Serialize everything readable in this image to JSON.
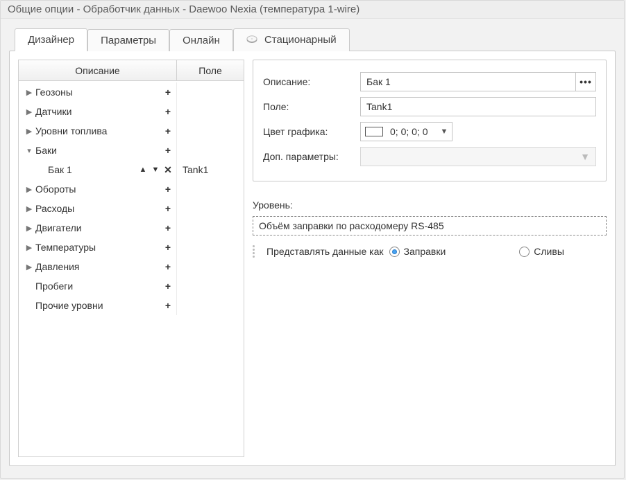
{
  "window": {
    "title": "Общие опции - Обработчик данных - Daewoo Nexia (температура 1-wire)"
  },
  "tabs": [
    {
      "label": "Дизайнер",
      "active": true
    },
    {
      "label": "Параметры",
      "active": false
    },
    {
      "label": "Онлайн",
      "active": false
    },
    {
      "label": "Стационарный",
      "active": false,
      "icon": "disk"
    }
  ],
  "tree": {
    "header": {
      "description": "Описание",
      "field": "Поле"
    },
    "rows": [
      {
        "label": "Геозоны",
        "expandable": true,
        "expanded": false
      },
      {
        "label": "Датчики",
        "expandable": true,
        "expanded": false
      },
      {
        "label": "Уровни топлива",
        "expandable": true,
        "expanded": false
      },
      {
        "label": "Баки",
        "expandable": true,
        "expanded": true,
        "children": [
          {
            "label": "Бак 1",
            "field": "Tank1",
            "selected": true
          }
        ]
      },
      {
        "label": "Обороты",
        "expandable": true,
        "expanded": false
      },
      {
        "label": "Расходы",
        "expandable": true,
        "expanded": false
      },
      {
        "label": "Двигатели",
        "expandable": true,
        "expanded": false
      },
      {
        "label": "Температуры",
        "expandable": true,
        "expanded": false
      },
      {
        "label": "Давления",
        "expandable": true,
        "expanded": false
      },
      {
        "label": "Пробеги",
        "expandable": false
      },
      {
        "label": "Прочие уровни",
        "expandable": false
      }
    ]
  },
  "props": {
    "labels": {
      "description": "Описание:",
      "field": "Поле:",
      "color": "Цвет графика:",
      "extra": "Доп. параметры:"
    },
    "description_value": "Бак 1",
    "field_value": "Tank1",
    "color_text": "0; 0; 0; 0",
    "color_swatch": "#ffffff"
  },
  "level": {
    "label": "Уровень:",
    "text": "Объём заправки по расходомеру RS-485"
  },
  "represent": {
    "label": "Представлять данные как",
    "option_fill": "Заправки",
    "option_drain": "Сливы",
    "selected": "fill"
  }
}
